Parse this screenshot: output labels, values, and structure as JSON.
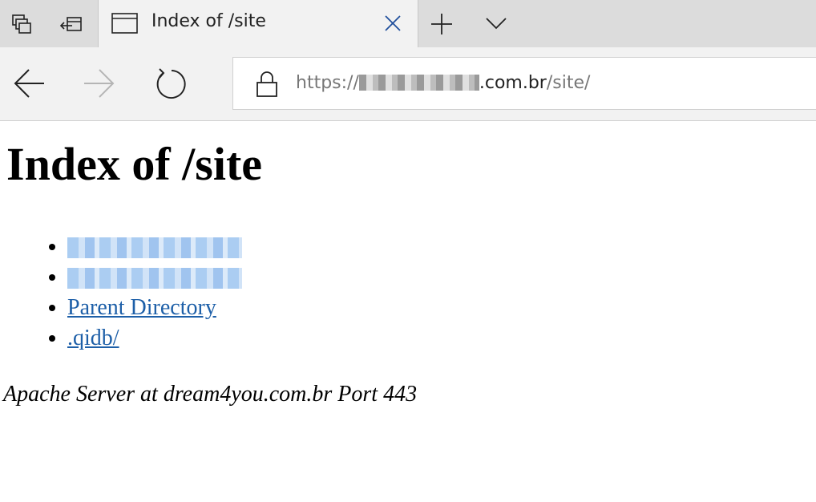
{
  "browser": {
    "tab": {
      "title": "Index of /site"
    },
    "address_bar": {
      "scheme": "https://",
      "host_visible": ".com.br",
      "path": "/site/"
    }
  },
  "page": {
    "heading": "Index of /site",
    "entries": [
      {
        "label": "",
        "redacted": true
      },
      {
        "label": "",
        "redacted": true
      },
      {
        "label": "Parent Directory",
        "redacted": false
      },
      {
        "label": ".qidb/",
        "redacted": false
      }
    ],
    "footer": "Apache Server at dream4you.com.br Port 443"
  },
  "colors": {
    "tabstrip": "#dcdcdc",
    "toolbar": "#f2f2f2",
    "link": "#1d5fa8"
  }
}
